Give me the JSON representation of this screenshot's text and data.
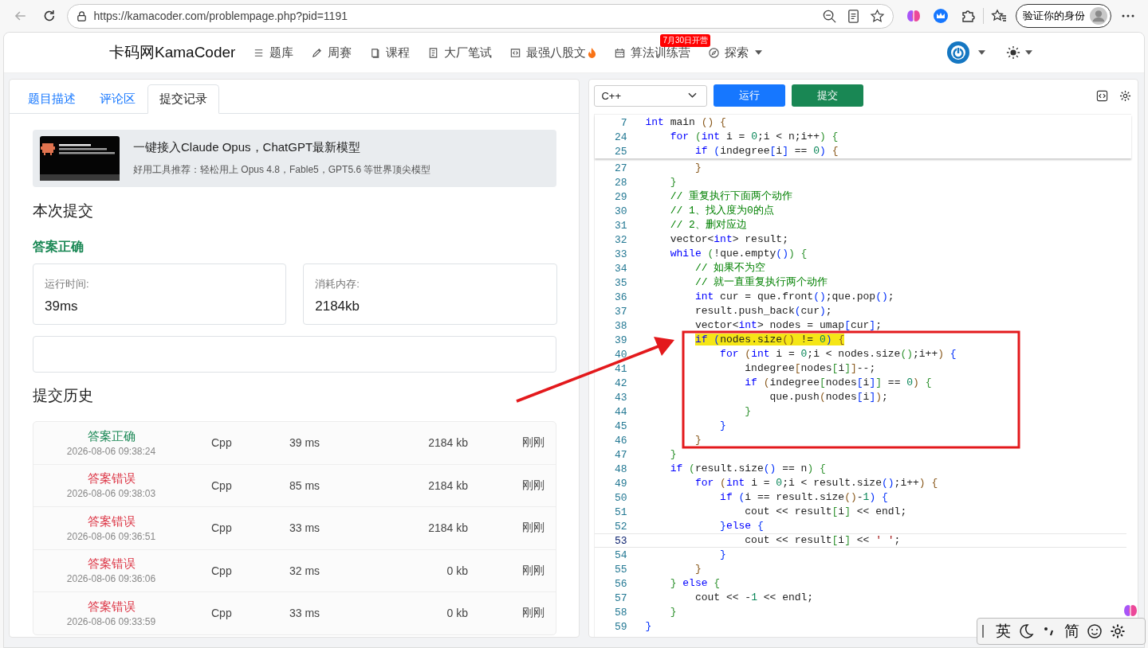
{
  "browser": {
    "url": "https://kamacoder.com/problempage.php?pid=1191",
    "profile_button": "验证你的身份"
  },
  "site": {
    "logo": "卡码网KamaCoder",
    "nav": [
      {
        "kind": "list",
        "label": "题库"
      },
      {
        "kind": "pencil",
        "label": "周赛"
      },
      {
        "kind": "book",
        "label": "课程"
      },
      {
        "kind": "doc",
        "label": "大厂笔试"
      },
      {
        "kind": "code",
        "label": "最强八股文",
        "fire": true
      },
      {
        "kind": "calendar",
        "label": "算法训练营",
        "badge": "7月30日开营"
      },
      {
        "kind": "compass",
        "label": "探索",
        "dropdown": true
      }
    ]
  },
  "left": {
    "tabs": [
      {
        "label": "题目描述",
        "selected": false
      },
      {
        "label": "评论区",
        "selected": false
      },
      {
        "label": "提交记录",
        "selected": true
      }
    ],
    "ad": {
      "title": "一键接入Claude Opus，ChatGPT最新模型",
      "subtitle": "好用工具推荐：轻松用上 Opus 4.8，Fable5，GPT5.6 等世界顶尖模型"
    },
    "current_heading": "本次提交",
    "result": "答案正确",
    "stats": [
      {
        "label": "运行时间:",
        "value": "39ms"
      },
      {
        "label": "消耗内存:",
        "value": "2184kb"
      }
    ],
    "history_heading": "提交历史",
    "history": [
      {
        "status": "答案正确",
        "accepted": true,
        "time": "2026-08-06 09:38:24",
        "lang": "Cpp",
        "runtime": "39 ms",
        "memory": "2184 kb",
        "when": "刚刚"
      },
      {
        "status": "答案错误",
        "accepted": false,
        "time": "2026-08-06 09:38:03",
        "lang": "Cpp",
        "runtime": "85 ms",
        "memory": "2184 kb",
        "when": "刚刚"
      },
      {
        "status": "答案错误",
        "accepted": false,
        "time": "2026-08-06 09:36:51",
        "lang": "Cpp",
        "runtime": "33 ms",
        "memory": "2184 kb",
        "when": "刚刚"
      },
      {
        "status": "答案错误",
        "accepted": false,
        "time": "2026-08-06 09:36:06",
        "lang": "Cpp",
        "runtime": "32 ms",
        "memory": "0 kb",
        "when": "刚刚"
      },
      {
        "status": "答案错误",
        "accepted": false,
        "time": "2026-08-06 09:33:59",
        "lang": "Cpp",
        "runtime": "33 ms",
        "memory": "0 kb",
        "when": "刚刚"
      }
    ]
  },
  "right": {
    "language": "C++",
    "run_button": "运行",
    "submit_button": "提交",
    "sticky_lines": [
      {
        "n": "7",
        "t": [
          {
            "kind": "kw",
            "text": "int"
          },
          {
            "kind": "pl",
            "text": " main "
          },
          {
            "kind": "b1",
            "text": "() {"
          }
        ]
      },
      {
        "n": "24",
        "t": [
          {
            "kind": "kw",
            "text": "    for"
          },
          {
            "kind": "b2",
            "text": " ("
          },
          {
            "kind": "kw",
            "text": "int"
          },
          {
            "kind": "pl",
            "text": " i = "
          },
          {
            "kind": "num",
            "text": "0"
          },
          {
            "kind": "pl",
            "text": ";i < n;i++"
          },
          {
            "kind": "b2",
            "text": ") {"
          }
        ]
      },
      {
        "n": "25",
        "t": [
          {
            "kind": "kw",
            "text": "        if"
          },
          {
            "kind": "b3",
            "text": " ("
          },
          {
            "kind": "pl",
            "text": "indegree"
          },
          {
            "kind": "b3",
            "text": "["
          },
          {
            "kind": "pl",
            "text": "i"
          },
          {
            "kind": "b3",
            "text": "]"
          },
          {
            "kind": "pl",
            "text": " == "
          },
          {
            "kind": "num",
            "text": "0"
          },
          {
            "kind": "b3",
            "text": ")"
          },
          {
            "kind": "b1",
            "text": " {"
          }
        ]
      }
    ],
    "lines": [
      {
        "n": "27",
        "highlighted": false,
        "current": false,
        "t": [
          {
            "kind": "b1",
            "text": "        }"
          }
        ]
      },
      {
        "n": "28",
        "highlighted": false,
        "current": false,
        "t": [
          {
            "kind": "b2",
            "text": "    }"
          }
        ]
      },
      {
        "n": "29",
        "highlighted": false,
        "current": false,
        "t": [
          {
            "kind": "cm",
            "text": "    // 重复执行下面两个动作"
          }
        ]
      },
      {
        "n": "30",
        "highlighted": false,
        "current": false,
        "t": [
          {
            "kind": "cm",
            "text": "    // 1、找入度为0的点"
          }
        ]
      },
      {
        "n": "31",
        "highlighted": false,
        "current": false,
        "t": [
          {
            "kind": "cm",
            "text": "    // 2、删对应边"
          }
        ]
      },
      {
        "n": "32",
        "highlighted": false,
        "current": false,
        "t": [
          {
            "kind": "pl",
            "text": "    vector<"
          },
          {
            "kind": "kw",
            "text": "int"
          },
          {
            "kind": "pl",
            "text": "> result;"
          }
        ]
      },
      {
        "n": "33",
        "highlighted": false,
        "current": false,
        "t": [
          {
            "kind": "kw",
            "text": "    while"
          },
          {
            "kind": "b2",
            "text": " ("
          },
          {
            "kind": "pl",
            "text": "!que.empty"
          },
          {
            "kind": "b3",
            "text": "()"
          },
          {
            "kind": "b2",
            "text": ") {"
          }
        ]
      },
      {
        "n": "34",
        "highlighted": false,
        "current": false,
        "t": [
          {
            "kind": "cm",
            "text": "        // 如果不为空"
          }
        ]
      },
      {
        "n": "35",
        "highlighted": false,
        "current": false,
        "t": [
          {
            "kind": "cm",
            "text": "        // 就一直重复执行两个动作"
          }
        ]
      },
      {
        "n": "36",
        "highlighted": false,
        "current": false,
        "t": [
          {
            "kind": "kw",
            "text": "        int"
          },
          {
            "kind": "pl",
            "text": " cur = que.front"
          },
          {
            "kind": "b3",
            "text": "()"
          },
          {
            "kind": "pl",
            "text": ";que.pop"
          },
          {
            "kind": "b3",
            "text": "()"
          },
          {
            "kind": "pl",
            "text": ";"
          }
        ]
      },
      {
        "n": "37",
        "highlighted": false,
        "current": false,
        "t": [
          {
            "kind": "pl",
            "text": "        result.push_back"
          },
          {
            "kind": "b3",
            "text": "("
          },
          {
            "kind": "pl",
            "text": "cur"
          },
          {
            "kind": "b3",
            "text": ")"
          },
          {
            "kind": "pl",
            "text": ";"
          }
        ]
      },
      {
        "n": "38",
        "highlighted": false,
        "current": false,
        "t": [
          {
            "kind": "pl",
            "text": "        vector<"
          },
          {
            "kind": "kw",
            "text": "int"
          },
          {
            "kind": "pl",
            "text": "> nodes = umap"
          },
          {
            "kind": "b3",
            "text": "["
          },
          {
            "kind": "pl",
            "text": "cur"
          },
          {
            "kind": "b3",
            "text": "]"
          },
          {
            "kind": "pl",
            "text": ";"
          }
        ]
      },
      {
        "n": "39",
        "highlighted": true,
        "current": false,
        "t": [
          {
            "kind": "kw",
            "text": "        if"
          },
          {
            "kind": "b3",
            "text": " ("
          },
          {
            "kind": "pl",
            "text": "nodes.size"
          },
          {
            "kind": "b1",
            "text": "()"
          },
          {
            "kind": "pl",
            "text": " != "
          },
          {
            "kind": "num",
            "text": "0"
          },
          {
            "kind": "b3",
            "text": ")"
          },
          {
            "kind": "b1",
            "text": " {"
          }
        ]
      },
      {
        "n": "40",
        "highlighted": false,
        "current": false,
        "t": [
          {
            "kind": "kw",
            "text": "            for"
          },
          {
            "kind": "b1",
            "text": " ("
          },
          {
            "kind": "kw",
            "text": "int"
          },
          {
            "kind": "pl",
            "text": " i = "
          },
          {
            "kind": "num",
            "text": "0"
          },
          {
            "kind": "pl",
            "text": ";i < nodes.size"
          },
          {
            "kind": "b2",
            "text": "()"
          },
          {
            "kind": "pl",
            "text": ";i++"
          },
          {
            "kind": "b1",
            "text": ")"
          },
          {
            "kind": "b3",
            "text": " {"
          }
        ]
      },
      {
        "n": "41",
        "highlighted": false,
        "current": false,
        "t": [
          {
            "kind": "pl",
            "text": "                indegree"
          },
          {
            "kind": "b1",
            "text": "["
          },
          {
            "kind": "pl",
            "text": "nodes"
          },
          {
            "kind": "b2",
            "text": "["
          },
          {
            "kind": "pl",
            "text": "i"
          },
          {
            "kind": "b2",
            "text": "]"
          },
          {
            "kind": "b1",
            "text": "]"
          },
          {
            "kind": "pl",
            "text": "--;"
          }
        ]
      },
      {
        "n": "42",
        "highlighted": false,
        "current": false,
        "t": [
          {
            "kind": "kw",
            "text": "                if"
          },
          {
            "kind": "b1",
            "text": " ("
          },
          {
            "kind": "pl",
            "text": "indegree"
          },
          {
            "kind": "b2",
            "text": "["
          },
          {
            "kind": "pl",
            "text": "nodes"
          },
          {
            "kind": "b3",
            "text": "["
          },
          {
            "kind": "pl",
            "text": "i"
          },
          {
            "kind": "b3",
            "text": "]"
          },
          {
            "kind": "b2",
            "text": "]"
          },
          {
            "kind": "pl",
            "text": " == "
          },
          {
            "kind": "num",
            "text": "0"
          },
          {
            "kind": "b1",
            "text": ")"
          },
          {
            "kind": "b2",
            "text": " {"
          }
        ]
      },
      {
        "n": "43",
        "highlighted": false,
        "current": false,
        "t": [
          {
            "kind": "pl",
            "text": "                    que.push"
          },
          {
            "kind": "b1",
            "text": "("
          },
          {
            "kind": "pl",
            "text": "nodes"
          },
          {
            "kind": "b3",
            "text": "["
          },
          {
            "kind": "pl",
            "text": "i"
          },
          {
            "kind": "b3",
            "text": "]"
          },
          {
            "kind": "b1",
            "text": ")"
          },
          {
            "kind": "pl",
            "text": ";"
          }
        ]
      },
      {
        "n": "44",
        "highlighted": false,
        "current": false,
        "t": [
          {
            "kind": "b2",
            "text": "                }"
          }
        ]
      },
      {
        "n": "45",
        "highlighted": false,
        "current": false,
        "t": [
          {
            "kind": "b3",
            "text": "            }"
          }
        ]
      },
      {
        "n": "46",
        "highlighted": false,
        "current": false,
        "t": [
          {
            "kind": "b1",
            "text": "        }"
          }
        ]
      },
      {
        "n": "47",
        "highlighted": false,
        "current": false,
        "t": [
          {
            "kind": "b2",
            "text": "    }"
          }
        ]
      },
      {
        "n": "48",
        "highlighted": false,
        "current": false,
        "t": [
          {
            "kind": "kw",
            "text": "    if"
          },
          {
            "kind": "b2",
            "text": " ("
          },
          {
            "kind": "pl",
            "text": "result.size"
          },
          {
            "kind": "b3",
            "text": "()"
          },
          {
            "kind": "pl",
            "text": " == n"
          },
          {
            "kind": "b2",
            "text": ") {"
          }
        ]
      },
      {
        "n": "49",
        "highlighted": false,
        "current": false,
        "t": [
          {
            "kind": "kw",
            "text": "        for"
          },
          {
            "kind": "b1",
            "text": " ("
          },
          {
            "kind": "kw",
            "text": "int"
          },
          {
            "kind": "pl",
            "text": " i = "
          },
          {
            "kind": "num",
            "text": "0"
          },
          {
            "kind": "pl",
            "text": ";i < result.size"
          },
          {
            "kind": "b3",
            "text": "()"
          },
          {
            "kind": "pl",
            "text": ";i++"
          },
          {
            "kind": "b1",
            "text": ") {"
          }
        ]
      },
      {
        "n": "50",
        "highlighted": false,
        "current": false,
        "t": [
          {
            "kind": "kw",
            "text": "            if"
          },
          {
            "kind": "b3",
            "text": " ("
          },
          {
            "kind": "pl",
            "text": "i == result.size"
          },
          {
            "kind": "b1",
            "text": "()"
          },
          {
            "kind": "pl",
            "text": "-"
          },
          {
            "kind": "num",
            "text": "1"
          },
          {
            "kind": "b3",
            "text": ") {"
          }
        ]
      },
      {
        "n": "51",
        "highlighted": false,
        "current": false,
        "t": [
          {
            "kind": "pl",
            "text": "                cout << result"
          },
          {
            "kind": "b2",
            "text": "["
          },
          {
            "kind": "pl",
            "text": "i"
          },
          {
            "kind": "b2",
            "text": "]"
          },
          {
            "kind": "pl",
            "text": " << endl;"
          }
        ]
      },
      {
        "n": "52",
        "highlighted": false,
        "current": false,
        "t": [
          {
            "kind": "b3",
            "text": "            }"
          },
          {
            "kind": "kw",
            "text": "else"
          },
          {
            "kind": "b3",
            "text": " {"
          }
        ]
      },
      {
        "n": "53",
        "highlighted": false,
        "current": true,
        "t": [
          {
            "kind": "pl",
            "text": "                cout << result"
          },
          {
            "kind": "b2",
            "text": "["
          },
          {
            "kind": "pl",
            "text": "i"
          },
          {
            "kind": "b2",
            "text": "]"
          },
          {
            "kind": "pl",
            "text": " << "
          },
          {
            "kind": "str",
            "text": "' '"
          },
          {
            "kind": "pl",
            "text": ";"
          }
        ]
      },
      {
        "n": "54",
        "highlighted": false,
        "current": false,
        "t": [
          {
            "kind": "b3",
            "text": "            }"
          }
        ]
      },
      {
        "n": "55",
        "highlighted": false,
        "current": false,
        "t": [
          {
            "kind": "b1",
            "text": "        }"
          }
        ]
      },
      {
        "n": "56",
        "highlighted": false,
        "current": false,
        "t": [
          {
            "kind": "b2",
            "text": "    }"
          },
          {
            "kind": "kw",
            "text": " else"
          },
          {
            "kind": "b2",
            "text": " {"
          }
        ]
      },
      {
        "n": "57",
        "highlighted": false,
        "current": false,
        "t": [
          {
            "kind": "pl",
            "text": "        cout << -"
          },
          {
            "kind": "num",
            "text": "1"
          },
          {
            "kind": "pl",
            "text": " << endl;"
          }
        ]
      },
      {
        "n": "58",
        "highlighted": false,
        "current": false,
        "t": [
          {
            "kind": "b2",
            "text": "    }"
          }
        ]
      },
      {
        "n": "59",
        "highlighted": false,
        "current": false,
        "t": [
          {
            "kind": "b3",
            "text": "}"
          }
        ]
      }
    ]
  },
  "ime": {
    "language": "英",
    "script": "简"
  }
}
